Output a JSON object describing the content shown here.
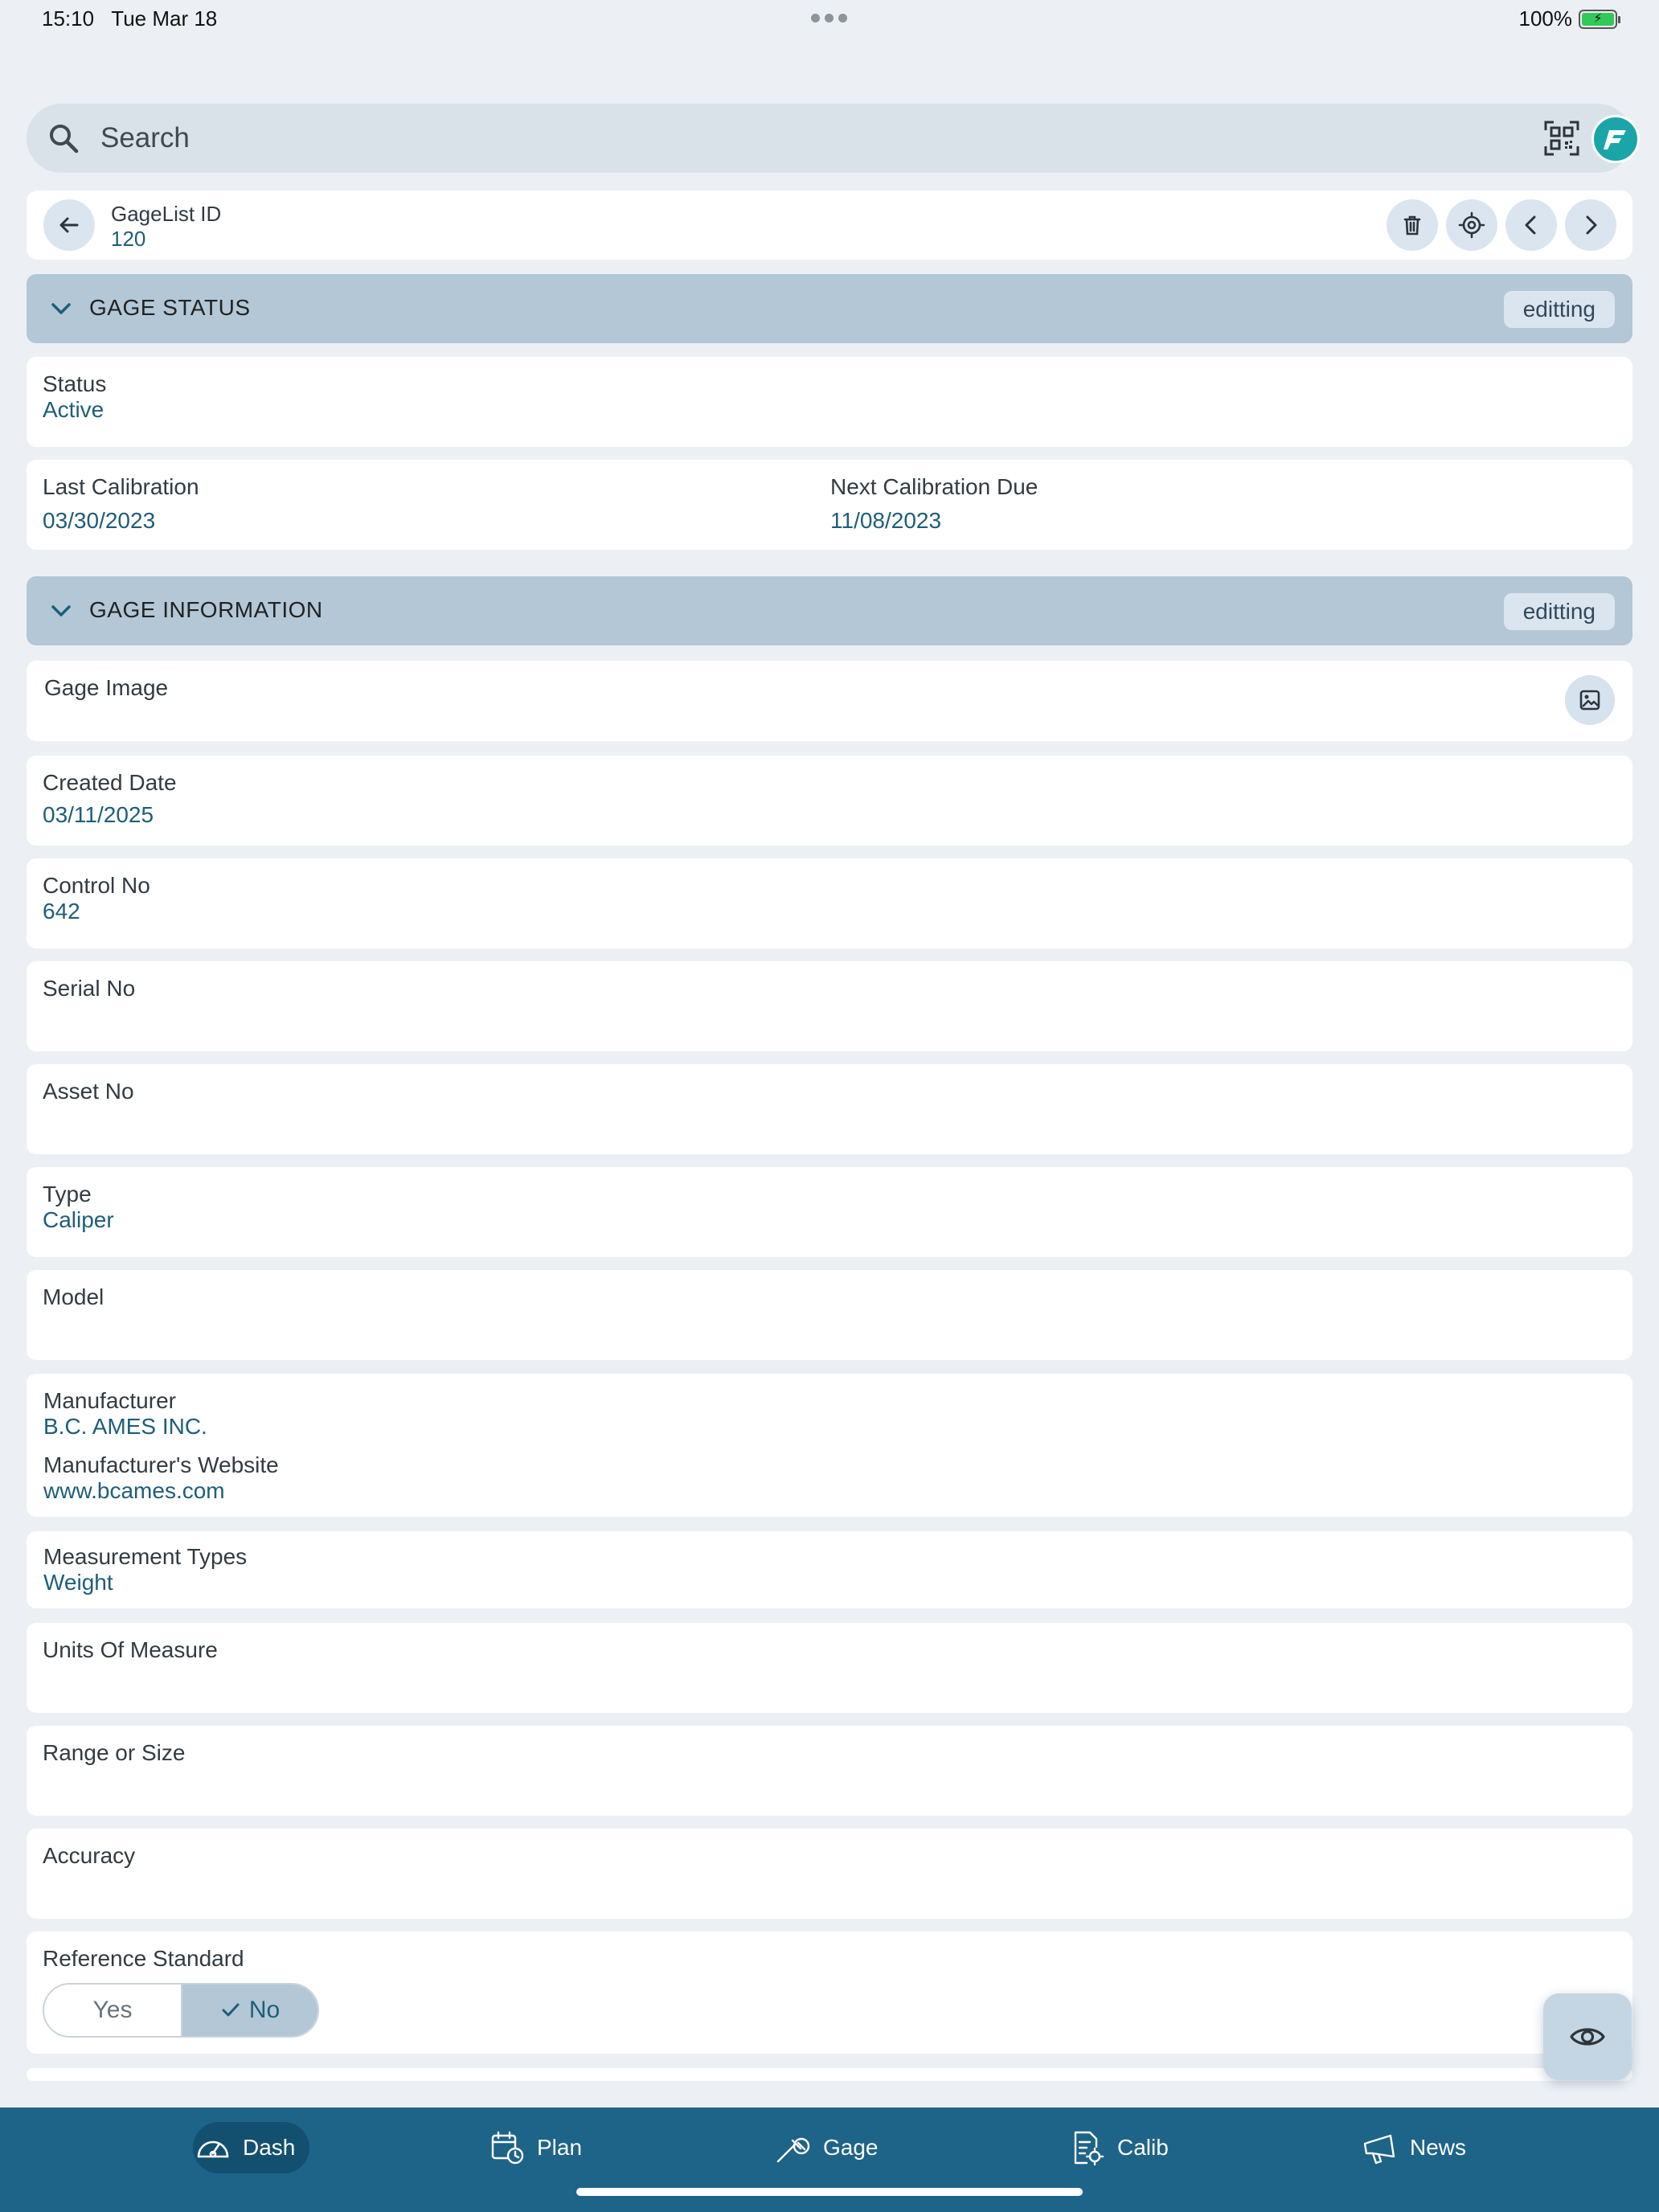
{
  "status_bar": {
    "time": "15:10",
    "date": "Tue Mar 18",
    "battery": "100%"
  },
  "search": {
    "placeholder": "Search"
  },
  "header": {
    "label": "GageList ID",
    "value": "120"
  },
  "sections": {
    "status": {
      "title": "GAGE STATUS",
      "badge": "editting"
    },
    "information": {
      "title": "GAGE INFORMATION",
      "badge": "editting"
    }
  },
  "fields": {
    "status": {
      "label": "Status",
      "value": "Active"
    },
    "last_calibration": {
      "label": "Last Calibration",
      "value": "03/30/2023"
    },
    "next_calibration": {
      "label": "Next Calibration Due",
      "value": "11/08/2023"
    },
    "gage_image": {
      "label": "Gage Image"
    },
    "created_date": {
      "label": "Created Date",
      "value": "03/11/2025"
    },
    "control_no": {
      "label": "Control No",
      "value": "642"
    },
    "serial_no": {
      "label": "Serial No",
      "value": ""
    },
    "asset_no": {
      "label": "Asset No",
      "value": ""
    },
    "type": {
      "label": "Type",
      "value": "Caliper"
    },
    "model": {
      "label": "Model",
      "value": ""
    },
    "manufacturer": {
      "label": "Manufacturer",
      "value": "B.C. AMES INC."
    },
    "manufacturer_website": {
      "label": "Manufacturer's Website",
      "value": "www.bcames.com"
    },
    "measurement_types": {
      "label": "Measurement Types",
      "value": "Weight"
    },
    "units_of_measure": {
      "label": "Units Of Measure",
      "value": ""
    },
    "range_or_size": {
      "label": "Range or Size",
      "value": ""
    },
    "accuracy": {
      "label": "Accuracy",
      "value": ""
    },
    "reference_standard": {
      "label": "Reference Standard",
      "options": [
        "Yes",
        "No"
      ],
      "selected": "No"
    }
  },
  "bottom_nav": {
    "items": [
      {
        "label": "Dash",
        "icon": "speedometer-icon",
        "active": true
      },
      {
        "label": "Plan",
        "icon": "calendar-clock-icon",
        "active": false
      },
      {
        "label": "Gage",
        "icon": "caliper-icon",
        "active": false
      },
      {
        "label": "Calib",
        "icon": "document-gear-icon",
        "active": false
      },
      {
        "label": "News",
        "icon": "megaphone-icon",
        "active": false
      }
    ]
  },
  "colors": {
    "background": "#ecf0f5",
    "section_bar": "#b3c7d6",
    "value_text": "#1e5e79",
    "bottom_nav": "#1e6388",
    "nav_active": "#13506f",
    "logo": "#1aa6a8"
  }
}
